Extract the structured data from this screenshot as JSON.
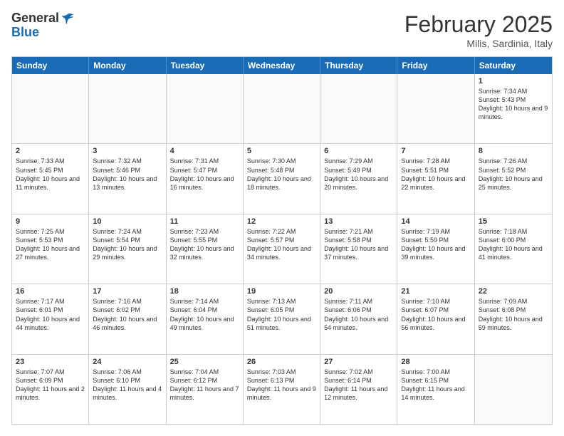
{
  "header": {
    "logo_line1": "General",
    "logo_line2": "Blue",
    "month": "February 2025",
    "location": "Milis, Sardinia, Italy"
  },
  "weekdays": [
    "Sunday",
    "Monday",
    "Tuesday",
    "Wednesday",
    "Thursday",
    "Friday",
    "Saturday"
  ],
  "rows": [
    [
      {
        "day": "",
        "text": ""
      },
      {
        "day": "",
        "text": ""
      },
      {
        "day": "",
        "text": ""
      },
      {
        "day": "",
        "text": ""
      },
      {
        "day": "",
        "text": ""
      },
      {
        "day": "",
        "text": ""
      },
      {
        "day": "1",
        "text": "Sunrise: 7:34 AM\nSunset: 5:43 PM\nDaylight: 10 hours and 9 minutes."
      }
    ],
    [
      {
        "day": "2",
        "text": "Sunrise: 7:33 AM\nSunset: 5:45 PM\nDaylight: 10 hours and 11 minutes."
      },
      {
        "day": "3",
        "text": "Sunrise: 7:32 AM\nSunset: 5:46 PM\nDaylight: 10 hours and 13 minutes."
      },
      {
        "day": "4",
        "text": "Sunrise: 7:31 AM\nSunset: 5:47 PM\nDaylight: 10 hours and 16 minutes."
      },
      {
        "day": "5",
        "text": "Sunrise: 7:30 AM\nSunset: 5:48 PM\nDaylight: 10 hours and 18 minutes."
      },
      {
        "day": "6",
        "text": "Sunrise: 7:29 AM\nSunset: 5:49 PM\nDaylight: 10 hours and 20 minutes."
      },
      {
        "day": "7",
        "text": "Sunrise: 7:28 AM\nSunset: 5:51 PM\nDaylight: 10 hours and 22 minutes."
      },
      {
        "day": "8",
        "text": "Sunrise: 7:26 AM\nSunset: 5:52 PM\nDaylight: 10 hours and 25 minutes."
      }
    ],
    [
      {
        "day": "9",
        "text": "Sunrise: 7:25 AM\nSunset: 5:53 PM\nDaylight: 10 hours and 27 minutes."
      },
      {
        "day": "10",
        "text": "Sunrise: 7:24 AM\nSunset: 5:54 PM\nDaylight: 10 hours and 29 minutes."
      },
      {
        "day": "11",
        "text": "Sunrise: 7:23 AM\nSunset: 5:55 PM\nDaylight: 10 hours and 32 minutes."
      },
      {
        "day": "12",
        "text": "Sunrise: 7:22 AM\nSunset: 5:57 PM\nDaylight: 10 hours and 34 minutes."
      },
      {
        "day": "13",
        "text": "Sunrise: 7:21 AM\nSunset: 5:58 PM\nDaylight: 10 hours and 37 minutes."
      },
      {
        "day": "14",
        "text": "Sunrise: 7:19 AM\nSunset: 5:59 PM\nDaylight: 10 hours and 39 minutes."
      },
      {
        "day": "15",
        "text": "Sunrise: 7:18 AM\nSunset: 6:00 PM\nDaylight: 10 hours and 41 minutes."
      }
    ],
    [
      {
        "day": "16",
        "text": "Sunrise: 7:17 AM\nSunset: 6:01 PM\nDaylight: 10 hours and 44 minutes."
      },
      {
        "day": "17",
        "text": "Sunrise: 7:16 AM\nSunset: 6:02 PM\nDaylight: 10 hours and 46 minutes."
      },
      {
        "day": "18",
        "text": "Sunrise: 7:14 AM\nSunset: 6:04 PM\nDaylight: 10 hours and 49 minutes."
      },
      {
        "day": "19",
        "text": "Sunrise: 7:13 AM\nSunset: 6:05 PM\nDaylight: 10 hours and 51 minutes."
      },
      {
        "day": "20",
        "text": "Sunrise: 7:11 AM\nSunset: 6:06 PM\nDaylight: 10 hours and 54 minutes."
      },
      {
        "day": "21",
        "text": "Sunrise: 7:10 AM\nSunset: 6:07 PM\nDaylight: 10 hours and 56 minutes."
      },
      {
        "day": "22",
        "text": "Sunrise: 7:09 AM\nSunset: 6:08 PM\nDaylight: 10 hours and 59 minutes."
      }
    ],
    [
      {
        "day": "23",
        "text": "Sunrise: 7:07 AM\nSunset: 6:09 PM\nDaylight: 11 hours and 2 minutes."
      },
      {
        "day": "24",
        "text": "Sunrise: 7:06 AM\nSunset: 6:10 PM\nDaylight: 11 hours and 4 minutes."
      },
      {
        "day": "25",
        "text": "Sunrise: 7:04 AM\nSunset: 6:12 PM\nDaylight: 11 hours and 7 minutes."
      },
      {
        "day": "26",
        "text": "Sunrise: 7:03 AM\nSunset: 6:13 PM\nDaylight: 11 hours and 9 minutes."
      },
      {
        "day": "27",
        "text": "Sunrise: 7:02 AM\nSunset: 6:14 PM\nDaylight: 11 hours and 12 minutes."
      },
      {
        "day": "28",
        "text": "Sunrise: 7:00 AM\nSunset: 6:15 PM\nDaylight: 11 hours and 14 minutes."
      },
      {
        "day": "",
        "text": ""
      }
    ]
  ]
}
